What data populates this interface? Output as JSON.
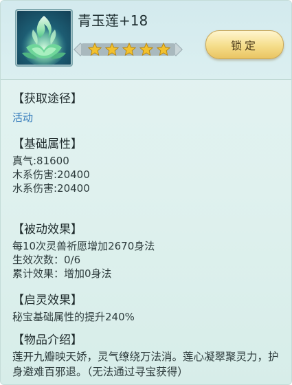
{
  "item": {
    "name": "青玉莲+18",
    "stars": 5,
    "lock_label": "锁定"
  },
  "obtain": {
    "title": "【获取途径】",
    "source": "活动"
  },
  "base": {
    "title": "【基础属性】",
    "lines": [
      "真气:81600",
      "木系伤害:20400",
      "水系伤害:20400"
    ]
  },
  "passive": {
    "title": "【被动效果】",
    "lines": [
      "每10次灵兽祈愿增加2670身法",
      "生效次数：0/6",
      "累计效果：增加0身法"
    ]
  },
  "awaken": {
    "title": "【启灵效果】",
    "lines": [
      "秘宝基础属性的提升240%"
    ]
  },
  "intro": {
    "title": "【物品介绍】",
    "text": "莲开九瓣映天娇，灵气缭绕万法消。莲心凝翠聚灵力，护身避难百邪退。（无法通过寻宝获得）"
  },
  "colors": {
    "star": "#f2c12e",
    "link": "#2a74b8",
    "button": "#f5dd8a"
  },
  "icons": [
    "lotus-flame-icon",
    "star-icon"
  ]
}
